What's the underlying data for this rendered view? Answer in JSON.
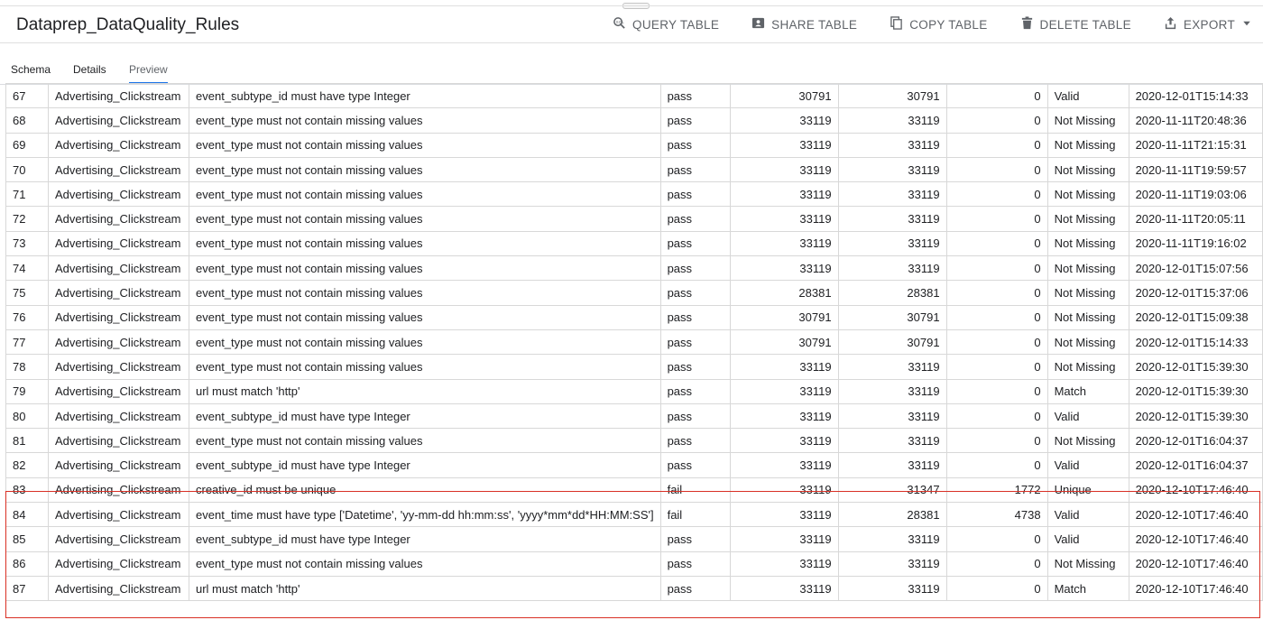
{
  "header": {
    "title": "Dataprep_DataQuality_Rules",
    "actions": [
      {
        "label": "QUERY TABLE",
        "icon": "query-icon"
      },
      {
        "label": "SHARE TABLE",
        "icon": "share-icon"
      },
      {
        "label": "COPY TABLE",
        "icon": "copy-icon"
      },
      {
        "label": "DELETE TABLE",
        "icon": "delete-icon"
      },
      {
        "label": "EXPORT",
        "icon": "export-icon"
      }
    ]
  },
  "tabs": [
    "Schema",
    "Details",
    "Preview"
  ],
  "active_tab": "Preview",
  "rows": [
    [
      "67",
      "Advertising_Clickstream",
      "event_subtype_id must have type Integer",
      "pass",
      "30791",
      "30791",
      "0",
      "Valid",
      "2020-12-01T15:14:33"
    ],
    [
      "68",
      "Advertising_Clickstream",
      "event_type must not contain missing values",
      "pass",
      "33119",
      "33119",
      "0",
      "Not Missing",
      "2020-11-11T20:48:36"
    ],
    [
      "69",
      "Advertising_Clickstream",
      "event_type must not contain missing values",
      "pass",
      "33119",
      "33119",
      "0",
      "Not Missing",
      "2020-11-11T21:15:31"
    ],
    [
      "70",
      "Advertising_Clickstream",
      "event_type must not contain missing values",
      "pass",
      "33119",
      "33119",
      "0",
      "Not Missing",
      "2020-11-11T19:59:57"
    ],
    [
      "71",
      "Advertising_Clickstream",
      "event_type must not contain missing values",
      "pass",
      "33119",
      "33119",
      "0",
      "Not Missing",
      "2020-11-11T19:03:06"
    ],
    [
      "72",
      "Advertising_Clickstream",
      "event_type must not contain missing values",
      "pass",
      "33119",
      "33119",
      "0",
      "Not Missing",
      "2020-11-11T20:05:11"
    ],
    [
      "73",
      "Advertising_Clickstream",
      "event_type must not contain missing values",
      "pass",
      "33119",
      "33119",
      "0",
      "Not Missing",
      "2020-11-11T19:16:02"
    ],
    [
      "74",
      "Advertising_Clickstream",
      "event_type must not contain missing values",
      "pass",
      "33119",
      "33119",
      "0",
      "Not Missing",
      "2020-12-01T15:07:56"
    ],
    [
      "75",
      "Advertising_Clickstream",
      "event_type must not contain missing values",
      "pass",
      "28381",
      "28381",
      "0",
      "Not Missing",
      "2020-12-01T15:37:06"
    ],
    [
      "76",
      "Advertising_Clickstream",
      "event_type must not contain missing values",
      "pass",
      "30791",
      "30791",
      "0",
      "Not Missing",
      "2020-12-01T15:09:38"
    ],
    [
      "77",
      "Advertising_Clickstream",
      "event_type must not contain missing values",
      "pass",
      "30791",
      "30791",
      "0",
      "Not Missing",
      "2020-12-01T15:14:33"
    ],
    [
      "78",
      "Advertising_Clickstream",
      "event_type must not contain missing values",
      "pass",
      "33119",
      "33119",
      "0",
      "Not Missing",
      "2020-12-01T15:39:30"
    ],
    [
      "79",
      "Advertising_Clickstream",
      "url must match 'http'",
      "pass",
      "33119",
      "33119",
      "0",
      "Match",
      "2020-12-01T15:39:30"
    ],
    [
      "80",
      "Advertising_Clickstream",
      "event_subtype_id must have type Integer",
      "pass",
      "33119",
      "33119",
      "0",
      "Valid",
      "2020-12-01T15:39:30"
    ],
    [
      "81",
      "Advertising_Clickstream",
      "event_type must not contain missing values",
      "pass",
      "33119",
      "33119",
      "0",
      "Not Missing",
      "2020-12-01T16:04:37"
    ],
    [
      "82",
      "Advertising_Clickstream",
      "event_subtype_id must have type Integer",
      "pass",
      "33119",
      "33119",
      "0",
      "Valid",
      "2020-12-01T16:04:37"
    ],
    [
      "83",
      "Advertising_Clickstream",
      "creative_id must be unique",
      "fail",
      "33119",
      "31347",
      "1772",
      "Unique",
      "2020-12-10T17:46:40"
    ],
    [
      "84",
      "Advertising_Clickstream",
      "event_time must have type ['Datetime', 'yy-mm-dd hh:mm:ss', 'yyyy*mm*dd*HH:MM:SS']",
      "fail",
      "33119",
      "28381",
      "4738",
      "Valid",
      "2020-12-10T17:46:40"
    ],
    [
      "85",
      "Advertising_Clickstream",
      "event_subtype_id must have type Integer",
      "pass",
      "33119",
      "33119",
      "0",
      "Valid",
      "2020-12-10T17:46:40"
    ],
    [
      "86",
      "Advertising_Clickstream",
      "event_type must not contain missing values",
      "pass",
      "33119",
      "33119",
      "0",
      "Not Missing",
      "2020-12-10T17:46:40"
    ],
    [
      "87",
      "Advertising_Clickstream",
      "url must match 'http'",
      "pass",
      "33119",
      "33119",
      "0",
      "Match",
      "2020-12-10T17:46:40"
    ]
  ],
  "colors": {
    "highlight": "#d93025",
    "active_tab_indicator": "#1a73e8"
  }
}
